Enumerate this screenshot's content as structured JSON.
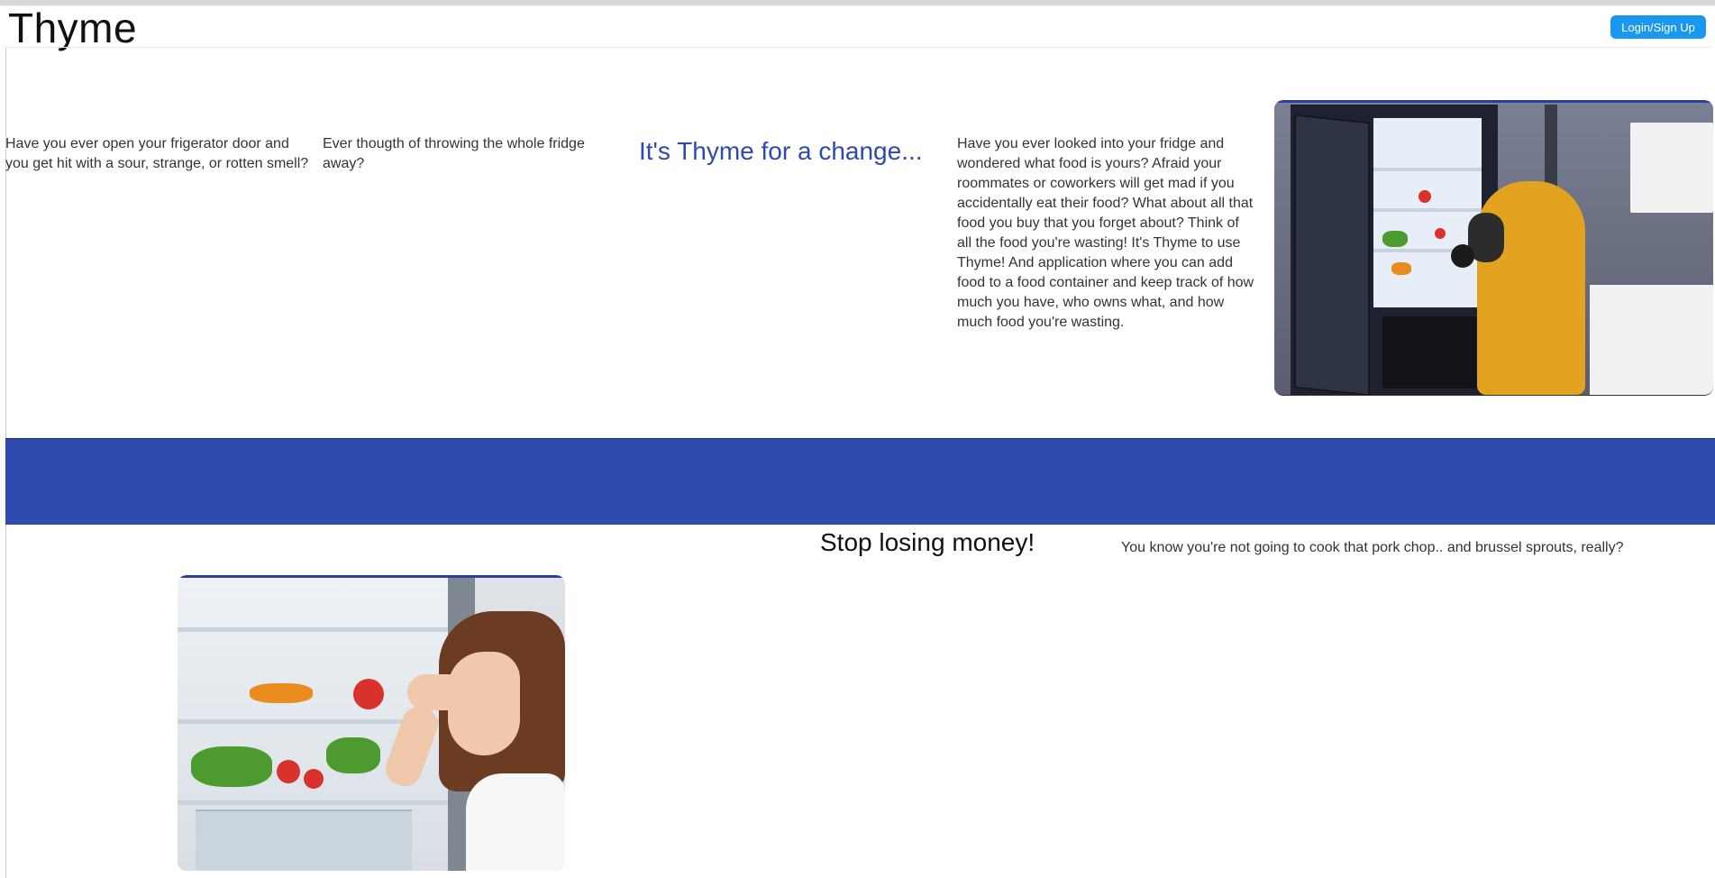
{
  "header": {
    "brand": "Thyme",
    "login_label": "Login/Sign Up"
  },
  "hero": {
    "question_1": "Have you ever open your frigerator door and you get hit with a sour, strange, or rotten smell?",
    "question_2": "Ever thougth of throwing the whole fridge away?",
    "tagline": "It's Thyme for a change...",
    "description": "Have you ever looked into your fridge and wondered what food is yours? Afraid your roommates or coworkers will get mad if you accidentally eat their food? What about all that food you buy that you forget about? Think of all the food you're wasting! It's Thyme to use Thyme! And application where you can add food to a food container and keep track of how much you have, who owns what, and how much food you're wasting."
  },
  "section2": {
    "title": "Stop losing money!",
    "text": "You know you're not going to cook that pork chop.. and brussel sprouts, really?"
  },
  "colors": {
    "accent_blue": "#2f4aad",
    "button_blue": "#1a98ef"
  },
  "images": {
    "hero_image": "person-in-hazmat-suit-opening-fridge",
    "section2_image": "woman-holding-nose-at-fridge"
  }
}
